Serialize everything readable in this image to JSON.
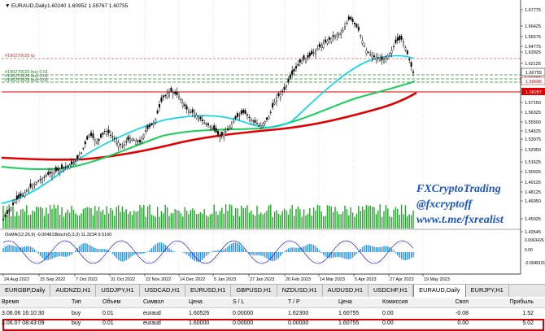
{
  "chart": {
    "title": "EURAUD,Daily",
    "ohlc": "1.60240 1.60952 1.59767 1.60755",
    "tp_label": "#190270025 tp",
    "buy_labels": [
      "#190270025 buy 0.01",
      "#190270024 buy 0.01",
      "#190270023 buy 0.01"
    ],
    "osma_label": "OsMA(12,26,9) -0.004810",
    "stoch_label": "Stoch(5,3,3) 11.3234 9.5160",
    "price_ticks": [
      "1.67775",
      "1.66425",
      "1.65575",
      "1.64775",
      "1.63925",
      "1.62125",
      "1.61050",
      "1.58287",
      "1.57150",
      "1.56325",
      "1.55500",
      "1.54625",
      "1.53975",
      "1.52950",
      "1.51625",
      "1.50025",
      "1.49125",
      "1.48125",
      "1.46950",
      "1.45025",
      "1.43545"
    ],
    "badges": {
      "current": "1.60755",
      "line_price": "1.59606",
      "red_level": "1.58287"
    },
    "osc_ticks": [
      "0.0063426",
      "0.00",
      "-0.0048101"
    ],
    "date_ticks": [
      "24 Aug 2022",
      "15 Sep 2022",
      "7 Oct 2022",
      "31 Oct 2022",
      "22 Nov 2022",
      "14 Dec 2022",
      "5 Jan 2023",
      "27 Jan 2023",
      "20 Feb 2023",
      "14 Mar 2023",
      "5 Apr 2023",
      "27 Apr 2023",
      "19 May 2023"
    ],
    "watermark": [
      "FXCryptoTrading",
      "@fxcryptoff",
      "www.t.me/fxrealist"
    ],
    "colors": {
      "bull": "#000000",
      "fast_ma": "#00d8e8",
      "mid_ma": "#19cf5a",
      "slow_ma": "#e00000",
      "volume": "#22a52a",
      "osma": "#1e90ff",
      "stoch": "#0000cc",
      "watermark": "#1c56c8"
    }
  },
  "tabs": [
    "EURGBP,Daily",
    "AUDNZD,H1",
    "USDJPY,H1",
    "USDCAD,H1",
    "EURUSD,H1",
    "GBPUSD,H1",
    "NZDUSD,H1",
    "AUDUSD,H1",
    "USDCHF,H1",
    "EURAUD,Daily",
    "EURJPY,H1"
  ],
  "active_tab": "EURAUD,Daily",
  "terminal": {
    "headers": [
      "Время",
      "Тип",
      "Объем",
      "Символ",
      "Цена",
      "S / L",
      "T / P",
      "Цена",
      "Комиссия",
      "Своп",
      "Прибыль"
    ],
    "rows": [
      [
        "3.06.06 16:10:30",
        "buy",
        "0.01",
        "euraud",
        "1.60526",
        "0.00000",
        "1.62300",
        "1.60755",
        "0.00",
        "-0.08",
        "1.52"
      ],
      [
        "3.06.07 08:43:09",
        "buy",
        "0.01",
        "euraud",
        "1.60000",
        "0.00000",
        "0.00000",
        "1.60755",
        "0.00",
        "0.00",
        "5.02"
      ]
    ]
  }
}
